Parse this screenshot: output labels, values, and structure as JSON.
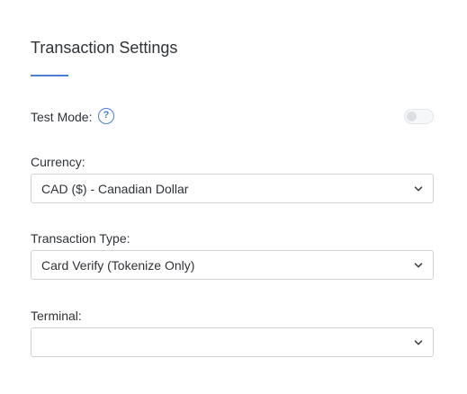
{
  "header": {
    "title": "Transaction Settings"
  },
  "test_mode": {
    "label": "Test Mode:",
    "help_icon_glyph": "?",
    "enabled": false
  },
  "currency": {
    "label": "Currency:",
    "value": "CAD ($) - Canadian Dollar"
  },
  "transaction_type": {
    "label": "Transaction Type:",
    "value": "Card Verify (Tokenize Only)"
  },
  "terminal": {
    "label": "Terminal:",
    "value": ""
  },
  "colors": {
    "accent": "#4a7fd6",
    "text": "#2f3337",
    "border": "#cfd3d8"
  },
  "icons": [
    "help-icon",
    "chevron-down-icon"
  ]
}
